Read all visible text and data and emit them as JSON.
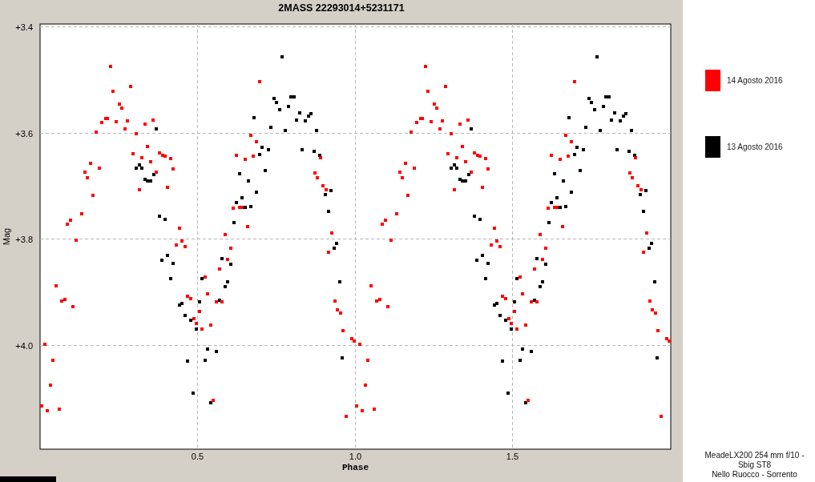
{
  "title": "2MASS 22293014+5231171",
  "chart": {
    "chart_data": {
      "type": "scatter",
      "grid": true,
      "xlabel": "Phase",
      "ylabel": "Mag",
      "xlim": [
        0,
        2.003
      ],
      "ylim": [
        4.196,
        3.395
      ],
      "xticks": [
        {
          "value": 0.5,
          "label": "0.5"
        },
        {
          "value": 1.0,
          "label": "1.0"
        },
        {
          "value": 1.5,
          "label": "1.5"
        }
      ],
      "yticks": [
        {
          "value": 3.4,
          "label": "+3.4"
        },
        {
          "value": 3.6,
          "label": "+3.6"
        },
        {
          "value": 3.8,
          "label": "+3.8"
        },
        {
          "value": 4.0,
          "label": "+4.0"
        }
      ],
      "series": [
        {
          "name": "14 Agosto 2016",
          "color": "#ff0000",
          "x": [
            0.224,
            0.288,
            0.232,
            0.252,
            0.26,
            0.209,
            0.214,
            0.196,
            0.242,
            0.277,
            0.27,
            0.333,
            0.359,
            0.178,
            0.305,
            0.341,
            0.295,
            0.323,
            0.379,
            0.389,
            0.397,
            0.415,
            0.351,
            0.422,
            0.369,
            0.16,
            0.188,
            0.142,
            0.15,
            0.316,
            0.405,
            0.168,
            0.132,
            0.097,
            0.087,
            0.115,
            0.443,
            0.45,
            0.433,
            0.461,
            0.051,
            0.069,
            0.079,
            0.104,
            0.468,
            0.478,
            0.506,
            0.489,
            0.496,
            0.015,
            0.041,
            0.033,
            0.005,
            0.023,
            0.061,
            0.697,
            0.669,
            0.687,
            0.623,
            0.651,
            0.677,
            0.891,
            0.873,
            0.88,
            0.898,
            0.908,
            0.613,
            0.634,
            0.641,
            0.659,
            0.588,
            0.926,
            0.606,
            0.595,
            0.57,
            0.524,
            0.532,
            0.56,
            0.578,
            0.542,
            0.514,
            0.55,
            0.916,
            0.936,
            0.944,
            0.954,
            0.962,
            0.99,
            0.998,
            0.972,
            1.224,
            1.288,
            1.232,
            1.252,
            1.26,
            1.209,
            1.214,
            1.196,
            1.242,
            1.277,
            1.27,
            1.333,
            1.359,
            1.178,
            1.305,
            1.341,
            1.295,
            1.323,
            1.379,
            1.389,
            1.397,
            1.415,
            1.351,
            1.422,
            1.369,
            1.16,
            1.188,
            1.142,
            1.15,
            1.316,
            1.405,
            1.168,
            1.132,
            1.097,
            1.087,
            1.115,
            1.443,
            1.45,
            1.433,
            1.461,
            1.051,
            1.069,
            1.079,
            1.104,
            1.468,
            1.478,
            1.506,
            1.489,
            1.496,
            1.015,
            1.041,
            1.033,
            1.005,
            1.023,
            1.061,
            1.697,
            1.669,
            1.687,
            1.623,
            1.651,
            1.677,
            1.891,
            1.873,
            1.88,
            1.898,
            1.908,
            1.613,
            1.634,
            1.641,
            1.659,
            1.588,
            1.926,
            1.606,
            1.595,
            1.57,
            1.524,
            1.532,
            1.56,
            1.578,
            1.542,
            1.514,
            1.55,
            1.916,
            1.936,
            1.944,
            1.954,
            1.962,
            1.99,
            1.998,
            1.972
          ],
          "values": [
            3.475,
            3.512,
            3.521,
            3.546,
            3.554,
            3.573,
            3.573,
            3.581,
            3.579,
            3.578,
            3.592,
            3.584,
            3.576,
            3.599,
            3.602,
            3.626,
            3.64,
            3.647,
            3.638,
            3.643,
            3.644,
            3.649,
            3.655,
            3.668,
            3.674,
            3.658,
            3.667,
            3.674,
            3.685,
            3.708,
            3.703,
            3.718,
            3.753,
            3.765,
            3.772,
            3.803,
            3.78,
            3.804,
            3.812,
            3.815,
            3.889,
            3.917,
            3.914,
            3.928,
            3.908,
            3.913,
            3.937,
            3.95,
            3.959,
            3.999,
            4.029,
            4.076,
            4.115,
            4.124,
            4.121,
            3.504,
            3.605,
            3.616,
            3.643,
            3.65,
            3.644,
            3.647,
            3.676,
            3.684,
            3.699,
            3.708,
            3.742,
            3.741,
            3.741,
            3.776,
            3.792,
            3.789,
            3.818,
            3.839,
            3.857,
            3.872,
            3.904,
            3.919,
            3.919,
            3.962,
            3.97,
            4.104,
            3.825,
            3.917,
            3.934,
            3.94,
            3.972,
            3.988,
            3.993,
            4.134,
            3.475,
            3.512,
            3.521,
            3.546,
            3.554,
            3.573,
            3.573,
            3.581,
            3.579,
            3.578,
            3.592,
            3.584,
            3.576,
            3.599,
            3.602,
            3.626,
            3.64,
            3.647,
            3.638,
            3.643,
            3.644,
            3.649,
            3.655,
            3.668,
            3.674,
            3.658,
            3.667,
            3.674,
            3.685,
            3.708,
            3.703,
            3.718,
            3.753,
            3.765,
            3.772,
            3.803,
            3.78,
            3.804,
            3.812,
            3.815,
            3.889,
            3.917,
            3.914,
            3.928,
            3.908,
            3.913,
            3.937,
            3.95,
            3.959,
            3.999,
            4.029,
            4.076,
            4.115,
            4.124,
            4.121,
            3.504,
            3.605,
            3.616,
            3.643,
            3.65,
            3.644,
            3.647,
            3.676,
            3.684,
            3.699,
            3.708,
            3.742,
            3.741,
            3.741,
            3.776,
            3.792,
            3.789,
            3.818,
            3.839,
            3.857,
            3.872,
            3.904,
            3.919,
            3.919,
            3.962,
            3.97,
            4.104,
            3.825,
            3.917,
            3.934,
            3.94,
            3.972,
            3.988,
            3.993,
            4.134
          ]
        },
        {
          "name": "13 Agosto 2016",
          "color": "#000000",
          "x": [
            0.369,
            0.316,
            0.305,
            0.323,
            0.361,
            0.333,
            0.341,
            0.351,
            0.379,
            0.397,
            0.405,
            0.387,
            0.422,
            0.415,
            0.45,
            0.443,
            0.506,
            0.461,
            0.478,
            0.496,
            0.468,
            0.486,
            0.768,
            0.743,
            0.751,
            0.796,
            0.807,
            0.789,
            0.761,
            0.824,
            0.86,
            0.852,
            0.814,
            0.842,
            0.679,
            0.733,
            0.779,
            0.878,
            0.705,
            0.725,
            0.832,
            0.87,
            0.888,
            0.697,
            0.715,
            0.634,
            0.662,
            0.687,
            0.924,
            0.906,
            0.641,
            0.623,
            0.651,
            0.669,
            0.616,
            0.916,
            0.941,
            0.934,
            0.578,
            0.606,
            0.514,
            0.595,
            0.588,
            0.57,
            0.532,
            0.56,
            0.524,
            0.542,
            0.952,
            0.959,
            1.369,
            1.316,
            1.305,
            1.323,
            1.361,
            1.333,
            1.341,
            1.351,
            1.379,
            1.397,
            1.405,
            1.387,
            1.422,
            1.415,
            1.45,
            1.443,
            1.506,
            1.461,
            1.478,
            1.496,
            1.468,
            1.486,
            1.768,
            1.743,
            1.751,
            1.796,
            1.807,
            1.789,
            1.761,
            1.824,
            1.86,
            1.852,
            1.814,
            1.842,
            1.679,
            1.733,
            1.779,
            1.878,
            1.705,
            1.725,
            1.832,
            1.87,
            1.888,
            1.697,
            1.715,
            1.634,
            1.662,
            1.687,
            1.924,
            1.906,
            1.641,
            1.623,
            1.651,
            1.669,
            1.616,
            1.916,
            1.941,
            1.934,
            1.578,
            1.606,
            1.514,
            1.595,
            1.588,
            1.57,
            1.532,
            1.56,
            1.524,
            1.542,
            1.952,
            1.959
          ],
          "values": [
            3.593,
            3.661,
            3.667,
            3.667,
            3.679,
            3.688,
            3.691,
            3.69,
            3.757,
            3.763,
            3.831,
            3.84,
            3.846,
            3.875,
            3.922,
            3.925,
            3.919,
            3.944,
            3.953,
            3.969,
            4.03,
            4.091,
            3.457,
            3.536,
            3.543,
            3.533,
            3.533,
            3.551,
            3.557,
            3.563,
            3.564,
            3.569,
            3.576,
            3.578,
            3.572,
            3.59,
            3.596,
            3.595,
            3.628,
            3.632,
            3.632,
            3.635,
            3.643,
            3.641,
            3.671,
            3.677,
            3.69,
            3.712,
            3.709,
            3.717,
            3.723,
            3.732,
            3.741,
            3.739,
            3.769,
            3.748,
            3.809,
            3.818,
            3.837,
            3.848,
            3.874,
            3.881,
            3.89,
            3.916,
            4.008,
            4.012,
            4.029,
            4.109,
            3.88,
            4.024,
            3.593,
            3.661,
            3.667,
            3.667,
            3.679,
            3.688,
            3.691,
            3.69,
            3.757,
            3.763,
            3.831,
            3.84,
            3.846,
            3.875,
            3.922,
            3.925,
            3.919,
            3.944,
            3.953,
            3.969,
            4.03,
            4.091,
            3.457,
            3.536,
            3.543,
            3.533,
            3.533,
            3.551,
            3.557,
            3.563,
            3.564,
            3.569,
            3.576,
            3.578,
            3.572,
            3.59,
            3.596,
            3.595,
            3.628,
            3.632,
            3.632,
            3.635,
            3.643,
            3.641,
            3.671,
            3.677,
            3.69,
            3.712,
            3.709,
            3.717,
            3.723,
            3.732,
            3.741,
            3.739,
            3.769,
            3.748,
            3.809,
            3.818,
            3.837,
            3.848,
            3.874,
            3.881,
            3.89,
            3.916,
            4.008,
            4.012,
            4.029,
            4.109,
            3.88,
            4.024
          ]
        }
      ]
    }
  },
  "credits": [
    "MeadeLX200 254 mm f/10 -",
    "Sbig ST8",
    "Nello Ruocco - Sorrento"
  ]
}
